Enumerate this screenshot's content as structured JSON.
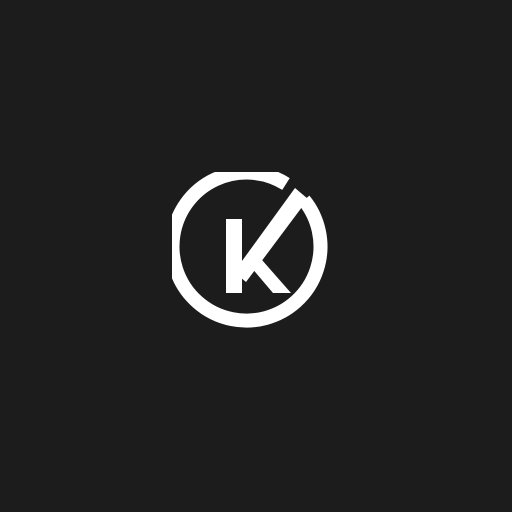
{
  "logo": {
    "letter": "K",
    "icon": "k-circle-logo-icon",
    "foreground_color": "#ffffff",
    "background_color": "#1c1c1c"
  }
}
